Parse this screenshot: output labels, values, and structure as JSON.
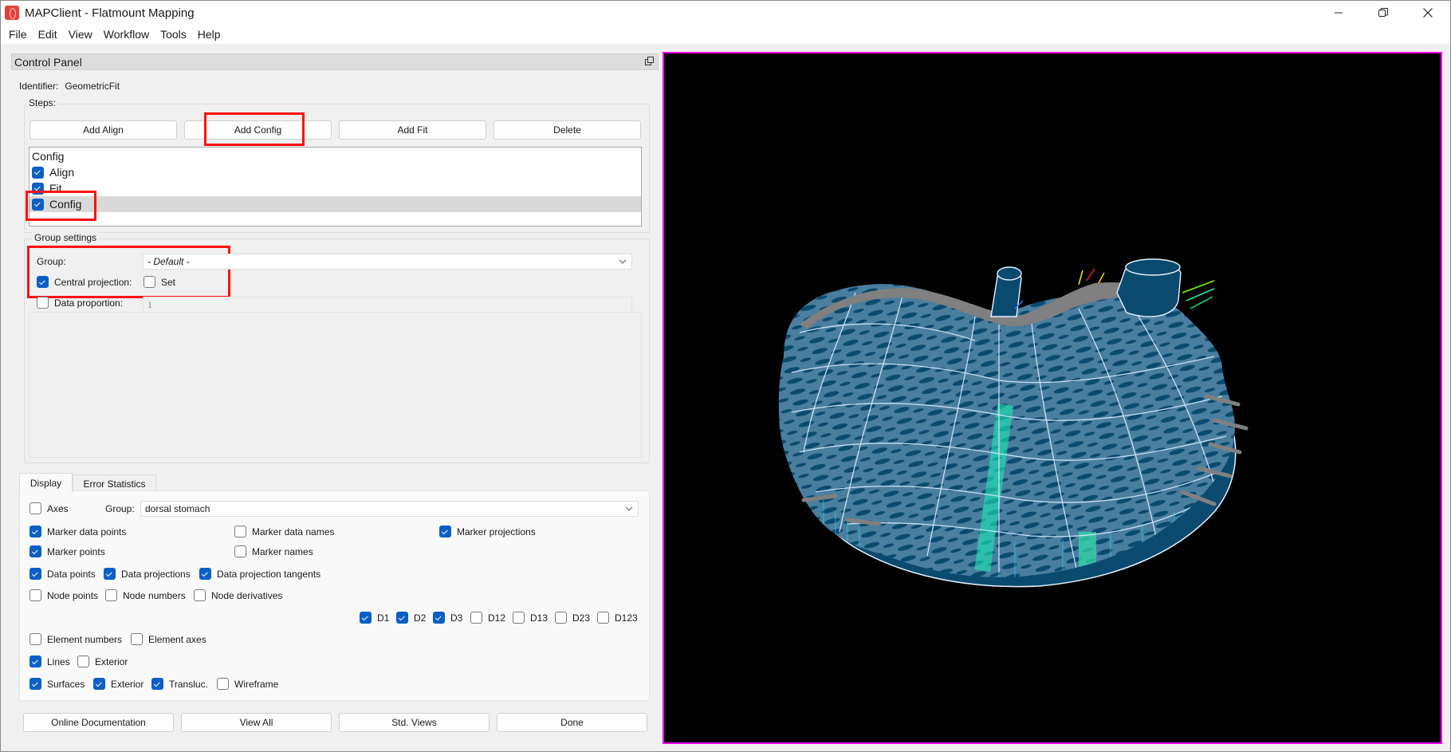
{
  "window": {
    "title": "MAPClient - Flatmount Mapping",
    "controls": [
      "minimize",
      "restore",
      "close"
    ]
  },
  "menu": [
    "File",
    "Edit",
    "View",
    "Workflow",
    "Tools",
    "Help"
  ],
  "control_panel": {
    "title": "Control Panel",
    "identifier_label": "Identifier:",
    "identifier_value": "GeometricFit",
    "steps": {
      "title": "Steps:",
      "buttons": {
        "add_align": "Add Align",
        "add_config": "Add Config",
        "add_fit": "Add Fit",
        "delete": "Delete"
      },
      "list": [
        {
          "label": "Config",
          "has_checkbox": false,
          "checked": false,
          "selected": false
        },
        {
          "label": "Align",
          "has_checkbox": true,
          "checked": true,
          "selected": false
        },
        {
          "label": "Fit",
          "has_checkbox": true,
          "checked": true,
          "selected": false
        },
        {
          "label": "Config",
          "has_checkbox": true,
          "checked": true,
          "selected": true
        }
      ]
    },
    "group_settings": {
      "title": "Group settings",
      "group_label": "Group:",
      "group_value": "- Default -",
      "central_projection_label": "Central projection:",
      "central_projection_checked": true,
      "set_label": "Set",
      "set_checked": false,
      "data_proportion_label": "Data proportion:",
      "data_proportion_checked": false,
      "data_proportion_value": "1"
    }
  },
  "tabs": [
    {
      "label": "Display",
      "active": true
    },
    {
      "label": "Error Statistics",
      "active": false
    }
  ],
  "display": {
    "axes": {
      "label": "Axes",
      "checked": false
    },
    "group_label": "Group:",
    "group_value": "dorsal stomach",
    "marker_data_points": {
      "label": "Marker data points",
      "checked": true
    },
    "marker_data_names": {
      "label": "Marker data names",
      "checked": false
    },
    "marker_projections": {
      "label": "Marker projections",
      "checked": true
    },
    "marker_points": {
      "label": "Marker points",
      "checked": true
    },
    "marker_names": {
      "label": "Marker names",
      "checked": false
    },
    "data_points": {
      "label": "Data points",
      "checked": true
    },
    "data_projections": {
      "label": "Data projections",
      "checked": true
    },
    "data_projection_tangents": {
      "label": "Data projection tangents",
      "checked": true
    },
    "node_points": {
      "label": "Node points",
      "checked": false
    },
    "node_numbers": {
      "label": "Node numbers",
      "checked": false
    },
    "node_derivatives": {
      "label": "Node derivatives",
      "checked": false
    },
    "derivatives": [
      {
        "label": "D1",
        "checked": true
      },
      {
        "label": "D2",
        "checked": true
      },
      {
        "label": "D3",
        "checked": true
      },
      {
        "label": "D12",
        "checked": false
      },
      {
        "label": "D13",
        "checked": false
      },
      {
        "label": "D23",
        "checked": false
      },
      {
        "label": "D123",
        "checked": false
      }
    ],
    "element_numbers": {
      "label": "Element numbers",
      "checked": false
    },
    "element_axes": {
      "label": "Element axes",
      "checked": false
    },
    "lines": {
      "label": "Lines",
      "checked": true
    },
    "lines_exterior": {
      "label": "Exterior",
      "checked": false
    },
    "surfaces": {
      "label": "Surfaces",
      "checked": true
    },
    "surfaces_exterior": {
      "label": "Exterior",
      "checked": true
    },
    "transluc": {
      "label": "Transluc.",
      "checked": true
    },
    "wireframe": {
      "label": "Wireframe",
      "checked": false
    }
  },
  "bottom_buttons": {
    "online_documentation": "Online Documentation",
    "view_all": "View All",
    "std_views": "Std. Views",
    "done": "Done"
  },
  "viewport": {
    "content": "3D stomach mesh with fitted surface, wireframe lines and data projections",
    "background": "#000000",
    "border_color": "#ff00ff",
    "surface_color": "#0b4a6f",
    "data_color": "#808080",
    "line_color": "#d8ecff",
    "projection_colors": [
      "#00e5ff",
      "#1de9b6",
      "#76ff03",
      "#ffea00",
      "#ff1744"
    ]
  }
}
